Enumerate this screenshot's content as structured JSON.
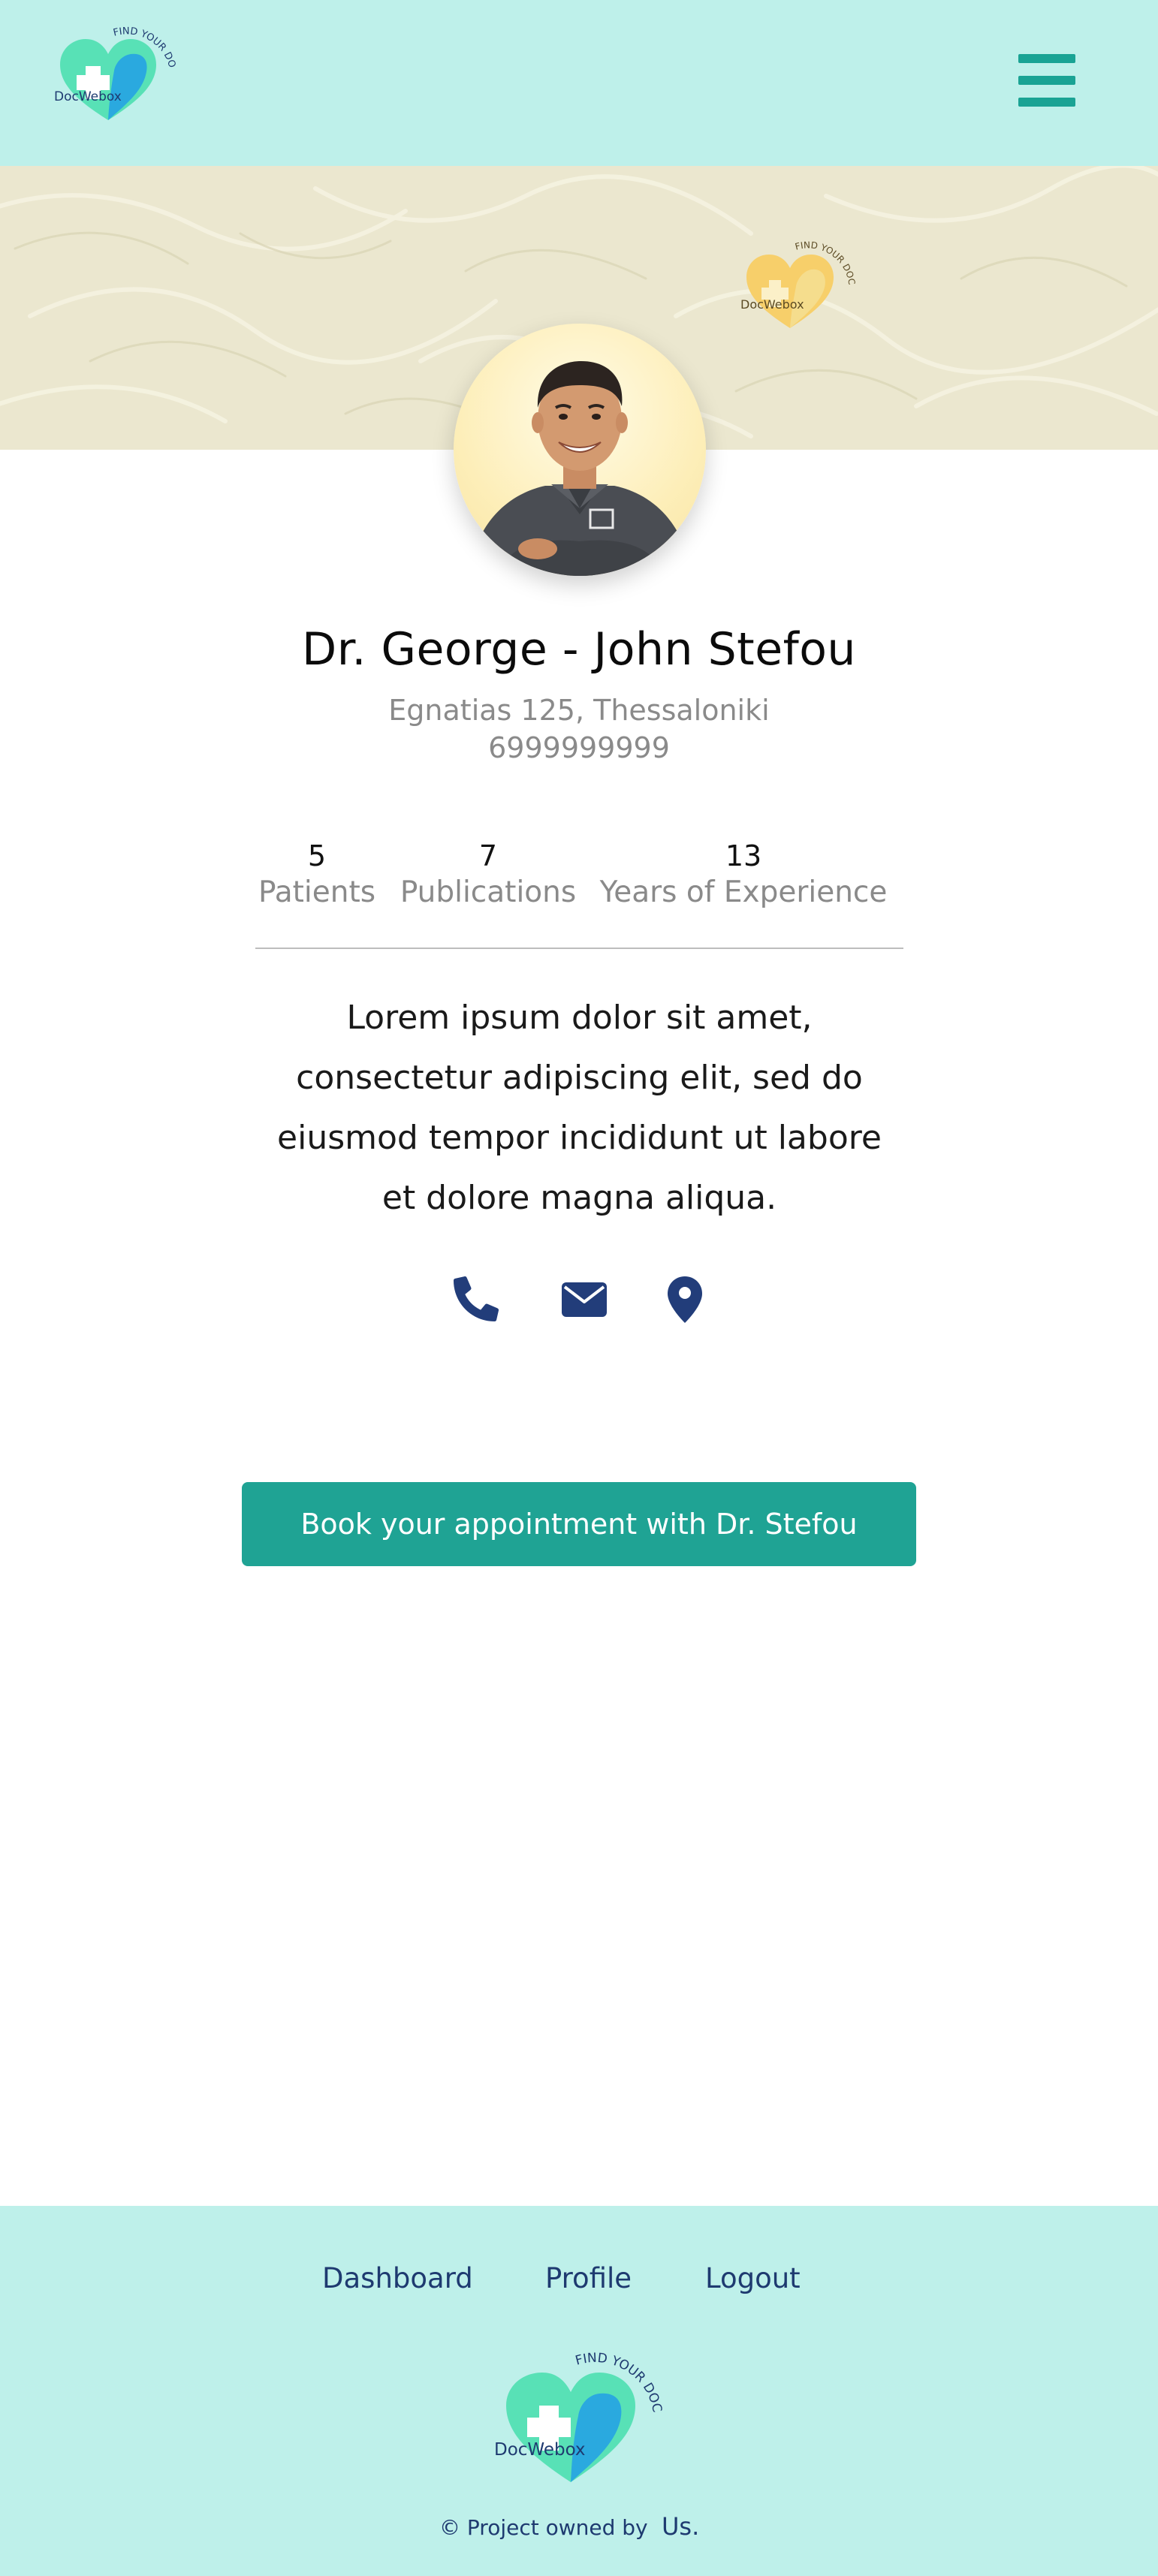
{
  "brand": {
    "name": "DocWebox",
    "tagline": "FIND YOUR DOCTOR"
  },
  "header": {
    "menu_icon": "hamburger-menu-icon"
  },
  "doctor": {
    "name": "Dr. George - John Stefou",
    "address": "Egnatias 125, Thessaloniki",
    "phone": "6999999999",
    "bio": "Lorem ipsum dolor sit amet, consectetur adipiscing elit, sed do eiusmod tempor incididunt ut labore et dolore magna aliqua."
  },
  "stats": [
    {
      "value": "5",
      "label": "Patients"
    },
    {
      "value": "7",
      "label": "Publications"
    },
    {
      "value": "13",
      "label": "Years of Experience"
    }
  ],
  "contacts": {
    "icons": [
      "phone-icon",
      "envelope-icon",
      "map-marker-icon"
    ]
  },
  "cta": {
    "label": "Book your appointment with Dr. Stefou"
  },
  "footer": {
    "links": [
      "Dashboard",
      "Profile",
      "Logout"
    ],
    "copyright": "© Project owned by",
    "owner": "Us."
  },
  "colors": {
    "header_bg": "#bef0ea",
    "accent": "#1fa394",
    "icon": "#223d7a",
    "heart_green": "#58e1b6",
    "heart_blue": "#2aa9df",
    "heart_yellow": "#f7cf6a"
  }
}
